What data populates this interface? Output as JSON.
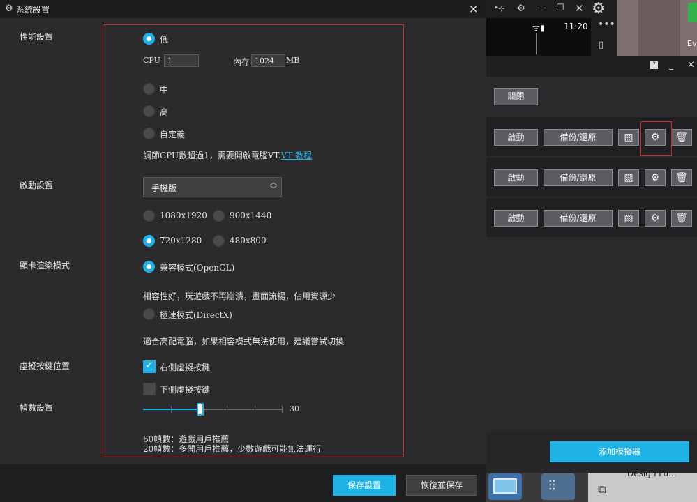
{
  "window": {
    "title": "系統設置",
    "close": "×"
  },
  "settings": {
    "labels": {
      "performance": "性能設置",
      "startup": "啟動設置",
      "render": "顯卡渲染模式",
      "virtual_keys": "虛擬按鍵位置",
      "frame_rate": "幀數設置"
    },
    "performance": {
      "options": [
        "低",
        "中",
        "高",
        "自定義"
      ],
      "selected": "低",
      "cpu_label": "CPU",
      "cpu_value": "1",
      "memory_label": "內存",
      "memory_value": "1024",
      "memory_unit": "MB",
      "hint": "調節CPU數超過1，需要開啟電腦VT.",
      "hint_link": "VT 教程"
    },
    "startup": {
      "select_value": "手機版",
      "resolutions": [
        "1080x1920",
        "900x1440",
        "720x1280",
        "480x800"
      ],
      "selected_resolution": "720x1280"
    },
    "render": {
      "compat_label": "兼容模式(OpenGL)",
      "compat_desc": "相容性好，玩遊戲不再崩潰，畫面流暢，佔用資源少",
      "speed_label": "極速模式(DirectX)",
      "speed_desc": "適合高配電腦，如果相容模式無法使用，建議嘗試切換",
      "selected": "compat"
    },
    "virtual_keys": {
      "right_label": "右側虛擬按鍵",
      "right_checked": true,
      "bottom_label": "下側虛擬按鍵",
      "bottom_checked": false
    },
    "frame_rate": {
      "value": "30",
      "fraction": 0.41,
      "note1": "60幀數：遊戲用戶推薦",
      "note2": "20幀數：多開用戶推薦，少數遊戲可能無法運行"
    }
  },
  "footer": {
    "save": "保存設置",
    "restore": "恢復並保存"
  },
  "right_panel": {
    "clock": "11:20",
    "ev_label": "Ev",
    "close_button": "關閉",
    "rows": [
      {
        "start": "啟動",
        "backup": "備份/還原"
      },
      {
        "start": "啟動",
        "backup": "備份/還原"
      },
      {
        "start": "啟動",
        "backup": "備份/還原"
      }
    ],
    "add_emulator": "添加模擬器",
    "taskbar_text": "Design Fu..."
  },
  "colors": {
    "accent": "#1fb2e6",
    "highlight_border": "#d22a2a"
  }
}
